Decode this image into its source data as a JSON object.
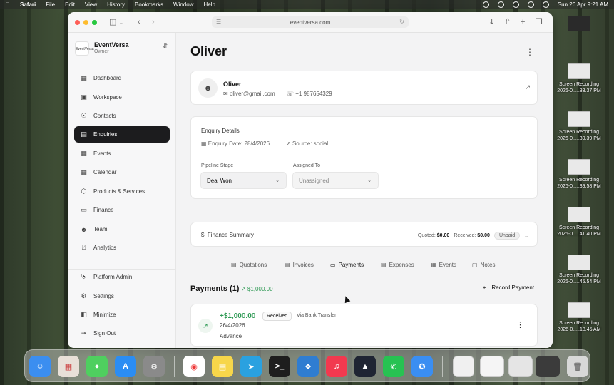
{
  "menubar": {
    "items": [
      "Safari",
      "File",
      "Edit",
      "View",
      "History",
      "Bookmarks",
      "Window",
      "Help"
    ],
    "clock": "Sun 26 Apr  9:21 AM"
  },
  "desktop": {
    "files": [
      {
        "line1": "",
        "line2": ""
      },
      {
        "line1": "Screen Recording",
        "line2": "2026-0.....33.37 PM"
      },
      {
        "line1": "Screen Recording",
        "line2": "2026-0.....39.39 PM"
      },
      {
        "line1": "Screen Recording",
        "line2": "2026-0.....39.58 PM"
      },
      {
        "line1": "Screen Recording",
        "line2": "2026-0.....41.40 PM"
      },
      {
        "line1": "Screen Recording",
        "line2": "2026-0.....45.54 PM"
      },
      {
        "line1": "Screen Recording",
        "line2": "2026-0.....18.45 AM"
      }
    ]
  },
  "browser": {
    "url": "eventversa.com"
  },
  "sidebar": {
    "org_name": "EventVersa",
    "org_role": "Owner",
    "logo_text": "EventVersa",
    "items": [
      {
        "label": "Dashboard",
        "icon": "grid-icon"
      },
      {
        "label": "Workspace",
        "icon": "briefcase-icon"
      },
      {
        "label": "Contacts",
        "icon": "user-circle-icon"
      },
      {
        "label": "Enquiries",
        "icon": "inbox-icon"
      },
      {
        "label": "Events",
        "icon": "calendar-icon"
      },
      {
        "label": "Calendar",
        "icon": "calendar-icon"
      },
      {
        "label": "Products & Services",
        "icon": "box-icon"
      },
      {
        "label": "Finance",
        "icon": "card-icon"
      },
      {
        "label": "Team",
        "icon": "users-icon"
      },
      {
        "label": "Analytics",
        "icon": "chart-icon"
      }
    ],
    "bottom_items": [
      {
        "label": "Platform Admin",
        "icon": "shield-icon"
      },
      {
        "label": "Settings",
        "icon": "gear-icon"
      },
      {
        "label": "Minimize",
        "icon": "collapse-icon"
      },
      {
        "label": "Sign Out",
        "icon": "logout-icon"
      }
    ],
    "active_index": 3
  },
  "page": {
    "title": "Oliver"
  },
  "contact": {
    "name": "Oliver",
    "email": "oliver@gmail.com",
    "phone": "+1 987654329"
  },
  "enquiry": {
    "section_title": "Enquiry Details",
    "date": "Enquiry Date: 28/4/2026",
    "source": "Source: social",
    "pipeline_label": "Pipeline Stage",
    "pipeline_value": "Deal Won",
    "assigned_label": "Assigned To",
    "assigned_value": "Unassigned"
  },
  "finance": {
    "title": "Finance Summary",
    "quoted_label": "Quoted:",
    "quoted_value": "$0.00",
    "received_label": "Received:",
    "received_value": "$0.00",
    "status": "Unpaid"
  },
  "tabs": [
    "Quotations",
    "Invoices",
    "Payments",
    "Expenses",
    "Events",
    "Notes"
  ],
  "active_tab": "Payments",
  "payments": {
    "title": "Payments (1)",
    "total": "$1,000.00",
    "record_label": "Record Payment",
    "items": [
      {
        "amount": "+$1,000.00",
        "status": "Received",
        "method": "Via Bank Transfer",
        "date": "26/4/2026",
        "type": "Advance"
      }
    ]
  },
  "colors": {
    "accent_green": "#2f9a55",
    "active_nav": "#1c1c1e"
  }
}
